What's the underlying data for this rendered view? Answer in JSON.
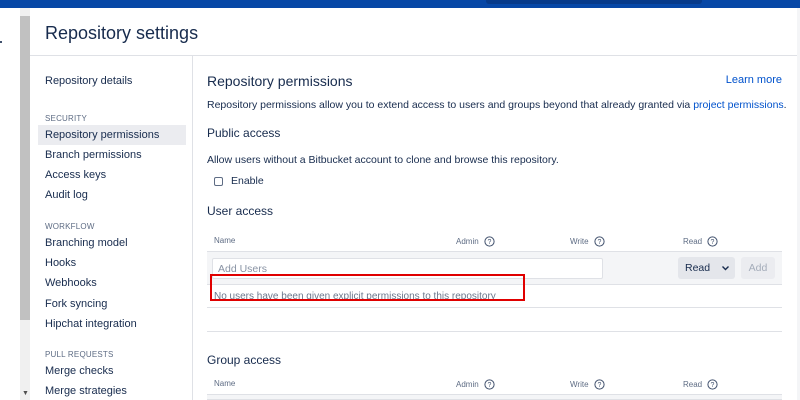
{
  "page": {
    "title": "Repository settings"
  },
  "sidebar": {
    "top_item": "Repository details",
    "sections": [
      {
        "heading": "SECURITY",
        "items": [
          "Repository permissions",
          "Branch permissions",
          "Access keys",
          "Audit log"
        ],
        "active": "Repository permissions"
      },
      {
        "heading": "WORKFLOW",
        "items": [
          "Branching model",
          "Hooks",
          "Webhooks",
          "Fork syncing",
          "Hipchat integration"
        ]
      },
      {
        "heading": "PULL REQUESTS",
        "items": [
          "Merge checks",
          "Merge strategies"
        ]
      }
    ]
  },
  "main": {
    "heading": "Repository permissions",
    "learn_more": "Learn more",
    "description": "Repository permissions allow you to extend access to users and groups beyond that already granted via",
    "description_link": "project permissions",
    "description_end": ".",
    "public_access": {
      "heading": "Public access",
      "text": "Allow users without a Bitbucket account to clone and browse this repository.",
      "checkbox_label": "Enable",
      "checked": false
    },
    "user_access": {
      "heading": "User access",
      "columns": [
        "Name",
        "Admin",
        "Write",
        "Read"
      ],
      "input_placeholder": "Add Users",
      "permission_value": "Read",
      "add_label": "Add",
      "empty_message": "No users have been given explicit permissions to this repository"
    },
    "group_access": {
      "heading": "Group access",
      "columns": [
        "Name",
        "Admin",
        "Write",
        "Read"
      ]
    }
  },
  "icons": {
    "help": "help-icon",
    "chevron": "chevron-down-icon",
    "scroll_down": "scroll-down-arrow-icon"
  },
  "colors": {
    "link": "#0052cc",
    "highlight": "#e00000",
    "topbar": "#0747a6"
  }
}
